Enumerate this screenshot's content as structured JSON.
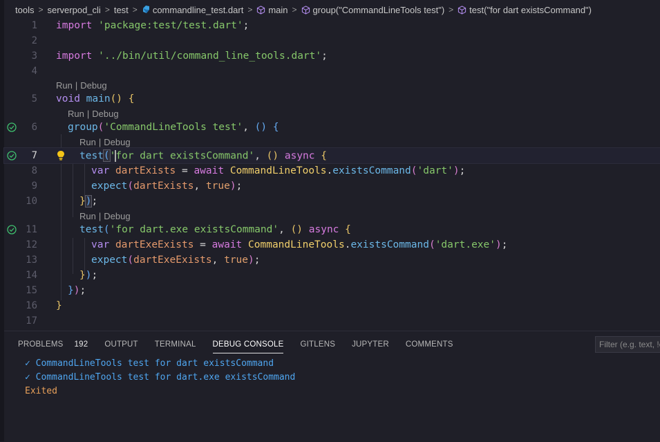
{
  "breadcrumb": {
    "items": [
      "tools",
      "serverpod_cli",
      "test",
      "commandline_test.dart",
      "main",
      "group(\"CommandLineTools test\")",
      "test(\"for dart existsCommand\")"
    ]
  },
  "editor": {
    "code_lens": {
      "run": "Run",
      "separator": "|",
      "debug": "Debug"
    },
    "line_numbers": [
      "1",
      "2",
      "3",
      "4",
      "5",
      "6",
      "7",
      "8",
      "9",
      "10",
      "11",
      "12",
      "13",
      "14",
      "15",
      "16",
      "17"
    ],
    "lines": {
      "l1": {
        "import": "import",
        "str": "'package:test/test.dart'",
        "end": ";"
      },
      "l3": {
        "import": "import",
        "str": "'../bin/util/command_line_tools.dart'",
        "end": ";"
      },
      "l5": {
        "void": "void",
        "main": "main",
        "paren": "()",
        "brace": "{"
      },
      "l6": {
        "fn": "group",
        "open": "(",
        "str": "'CommandLineTools test'",
        "comma": ", ",
        "lambda": "()",
        "brace": "{"
      },
      "l7": {
        "fn": "test",
        "open": "(",
        "quote": "'",
        "str": "for dart existsCommand'",
        "comma": ", ",
        "lambda": "()",
        "async": "async",
        "brace": "{"
      },
      "l8": {
        "var": "var",
        "name": "dartExists",
        "eq": " = ",
        "await": "await",
        "cls": "CommandLineTools",
        "dot": ".",
        "method": "existsCommand",
        "open": "(",
        "str": "'dart'",
        "close": ")",
        "end": ";"
      },
      "l9": {
        "fn": "expect",
        "open": "(",
        "name": "dartExists",
        "comma": ", ",
        "val": "true",
        "close": ")",
        "end": ";"
      },
      "l10": {
        "brace": "}",
        "close": ")",
        "end": ";"
      },
      "l11": {
        "fn": "test",
        "open": "(",
        "str": "'for dart.exe existsCommand'",
        "comma": ", ",
        "lambda": "()",
        "async": "async",
        "brace": "{"
      },
      "l12": {
        "var": "var",
        "name": "dartExeExists",
        "eq": " = ",
        "await": "await",
        "cls": "CommandLineTools",
        "dot": ".",
        "method": "existsCommand",
        "open": "(",
        "str": "'dart.exe'",
        "close": ")",
        "end": ";"
      },
      "l13": {
        "fn": "expect",
        "open": "(",
        "name": "dartExeExists",
        "comma": ", ",
        "val": "true",
        "close": ")",
        "end": ";"
      },
      "l14": {
        "brace": "}",
        "close": ")",
        "end": ";"
      },
      "l15": {
        "brace": "}",
        "close": ")",
        "end": ";"
      },
      "l16": {
        "brace": "}"
      }
    }
  },
  "panel": {
    "tabs": [
      "PROBLEMS",
      "OUTPUT",
      "TERMINAL",
      "DEBUG CONSOLE",
      "GITLENS",
      "JUPYTER",
      "COMMENTS"
    ],
    "active_tab": "DEBUG CONSOLE",
    "problems_count": "192",
    "filter_placeholder": "Filter (e.g. text, !exclude)",
    "console_lines": [
      "✓ CommandLineTools test for dart existsCommand",
      "✓ CommandLineTools test for dart.exe existsCommand",
      "Exited"
    ]
  },
  "icons": {
    "file": "dart-file-icon",
    "symbol": "cube-symbol-icon",
    "test_passed": "check-circle-icon",
    "hint": "lightbulb-icon"
  },
  "colors": {
    "background": "#1f1f28",
    "pass_green": "#3fbf6e",
    "console_blue": "#4fa6f0",
    "exited_orange": "#e8a05a"
  }
}
